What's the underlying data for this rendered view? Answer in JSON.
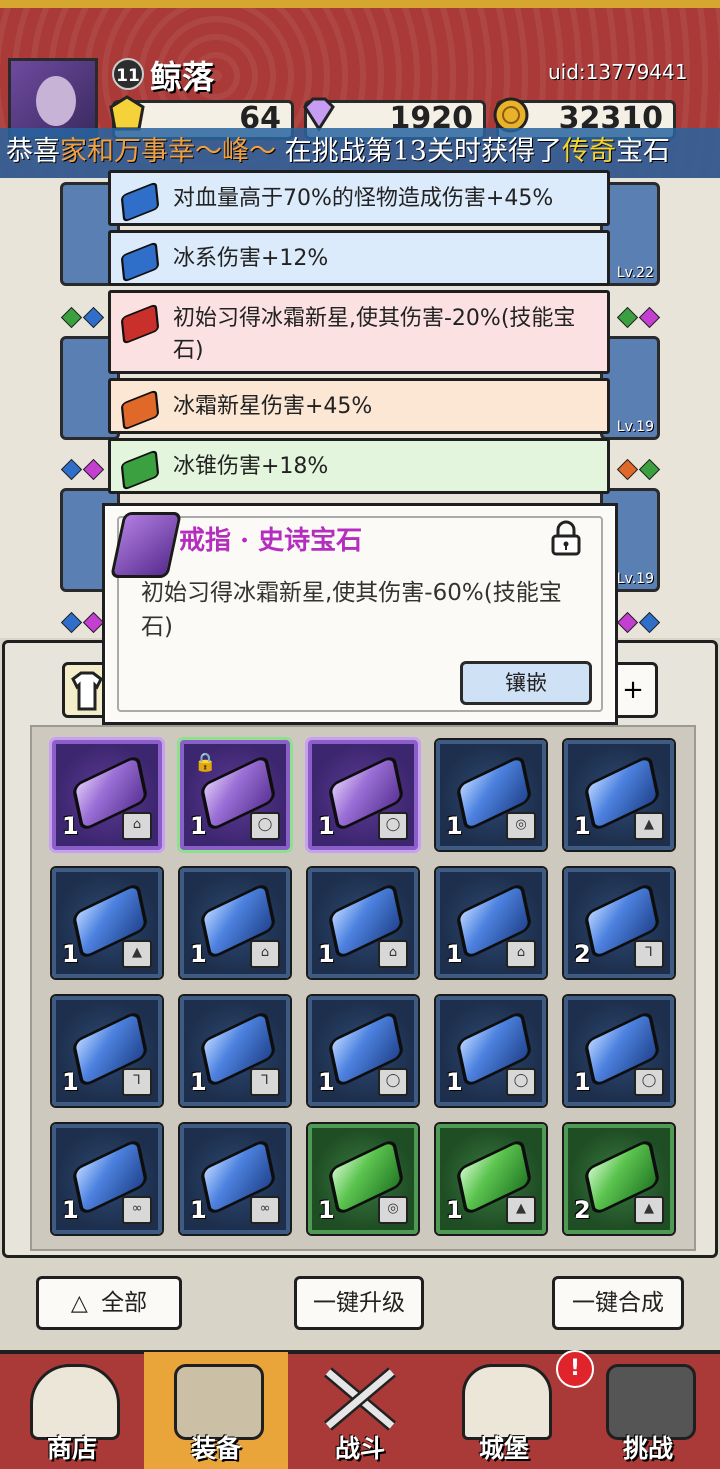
{
  "player": {
    "name": "鲸落",
    "level": "11",
    "uid": "uid:13779441"
  },
  "currencies": [
    {
      "icon": "gold-gem-icon",
      "value": "64"
    },
    {
      "icon": "purple-diamond-icon",
      "value": "1920"
    },
    {
      "icon": "coin-icon",
      "value": "32310"
    }
  ],
  "ticker": {
    "p1": "恭喜",
    "name": "家和万事幸～峰～",
    "p2": " 在挑战第13关时获得了",
    "rarity": "传奇",
    "p3": "宝石"
  },
  "equipment_slots": [
    {
      "level": ""
    },
    {
      "level": "Lv.22"
    },
    {
      "level": ""
    },
    {
      "level": "Lv.19"
    },
    {
      "level": ""
    },
    {
      "level": "Lv.19"
    }
  ],
  "affixes": [
    {
      "text": "对血量高于70%的怪物造成伤害+45%",
      "color": "#2f6fc9"
    },
    {
      "text": "冰系伤害+12%",
      "color": "#2f6fc9"
    },
    {
      "text": "初始习得冰霜新星,使其伤害-20%(技能宝石)",
      "color": "#c9302c"
    },
    {
      "text": "冰霜新星伤害+45%",
      "color": "#e0692a"
    },
    {
      "text": "冰锥伤害+18%",
      "color": "#3aa040"
    }
  ],
  "popup": {
    "title": "戒指 · 史诗宝石",
    "desc": "初始习得冰霜新星,使其伤害-60%(技能宝石)",
    "inlay_label": "镶嵌"
  },
  "inventory": [
    {
      "rarity": "purple",
      "count": "1",
      "slot": "boot"
    },
    {
      "rarity": "purple",
      "count": "1",
      "slot": "ring",
      "locked": true,
      "selected": true
    },
    {
      "rarity": "purple",
      "count": "1",
      "slot": "ring"
    },
    {
      "rarity": "blue",
      "count": "1",
      "slot": "amulet"
    },
    {
      "rarity": "blue",
      "count": "1",
      "slot": "armor"
    },
    {
      "rarity": "blue",
      "count": "1",
      "slot": "armor"
    },
    {
      "rarity": "blue",
      "count": "1",
      "slot": "boot"
    },
    {
      "rarity": "blue",
      "count": "1",
      "slot": "boot"
    },
    {
      "rarity": "blue",
      "count": "1",
      "slot": "boot"
    },
    {
      "rarity": "blue",
      "count": "2",
      "slot": "weapon"
    },
    {
      "rarity": "blue",
      "count": "1",
      "slot": "weapon"
    },
    {
      "rarity": "blue",
      "count": "1",
      "slot": "weapon"
    },
    {
      "rarity": "blue",
      "count": "1",
      "slot": "ring"
    },
    {
      "rarity": "blue",
      "count": "1",
      "slot": "ring"
    },
    {
      "rarity": "blue",
      "count": "1",
      "slot": "ring"
    },
    {
      "rarity": "blue",
      "count": "1",
      "slot": "bracelet"
    },
    {
      "rarity": "blue",
      "count": "1",
      "slot": "bracelet"
    },
    {
      "rarity": "green",
      "count": "1",
      "slot": "amulet"
    },
    {
      "rarity": "green",
      "count": "1",
      "slot": "armor"
    },
    {
      "rarity": "green",
      "count": "2",
      "slot": "armor"
    }
  ],
  "buttons": {
    "filter": "全部",
    "upgrade": "一键升级",
    "combine": "一键合成"
  },
  "nav": [
    {
      "label": "商店",
      "icon": "shop-icon"
    },
    {
      "label": "装备",
      "icon": "backpack-icon"
    },
    {
      "label": "战斗",
      "icon": "crossed-swords-icon"
    },
    {
      "label": "城堡",
      "icon": "castle-icon"
    },
    {
      "label": "挑战",
      "icon": "locked-armor-icon"
    }
  ],
  "alert": "!"
}
